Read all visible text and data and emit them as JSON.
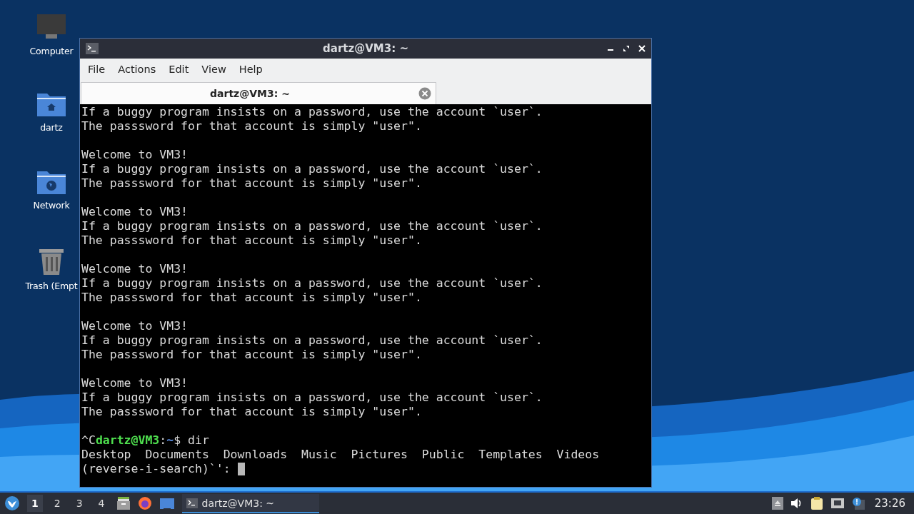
{
  "desktop_icons": [
    {
      "label": "Computer",
      "kind": "computer"
    },
    {
      "label": "dartz",
      "kind": "home"
    },
    {
      "label": "Network",
      "kind": "network"
    },
    {
      "label": "Trash (Empt",
      "kind": "trash"
    }
  ],
  "window": {
    "title": "dartz@VM3: ~",
    "active": true
  },
  "menu": [
    "File",
    "Actions",
    "Edit",
    "View",
    "Help"
  ],
  "tabs": [
    {
      "label": "dartz@VM3: ~",
      "selected": true
    }
  ],
  "terminal": {
    "blocks": [
      {
        "lines": [
          "If a buggy program insists on a password, use the account `user`.",
          "The passsword for that account is simply \"user\"."
        ]
      },
      {
        "lines": [
          "Welcome to VM3!",
          "If a buggy program insists on a password, use the account `user`.",
          "The passsword for that account is simply \"user\"."
        ]
      },
      {
        "lines": [
          "Welcome to VM3!",
          "If a buggy program insists on a password, use the account `user`.",
          "The passsword for that account is simply \"user\"."
        ]
      },
      {
        "lines": [
          "Welcome to VM3!",
          "If a buggy program insists on a password, use the account `user`.",
          "The passsword for that account is simply \"user\"."
        ]
      },
      {
        "lines": [
          "Welcome to VM3!",
          "If a buggy program insists on a password, use the account `user`.",
          "The passsword for that account is simply \"user\"."
        ]
      },
      {
        "lines": [
          "Welcome to VM3!",
          "If a buggy program insists on a password, use the account `user`.",
          "The passsword for that account is simply \"user\"."
        ]
      }
    ],
    "prompt": {
      "prefix": "^C",
      "user_host": "dartz@VM3",
      "separator": ":",
      "path": "~",
      "symbol": "$",
      "command": "dir"
    },
    "output": "Desktop  Documents  Downloads  Music  Pictures  Public  Templates  Videos",
    "search": "(reverse-i-search)`': "
  },
  "taskbar": {
    "workspaces": [
      {
        "label": "1",
        "selected": true
      },
      {
        "label": "2",
        "selected": false
      },
      {
        "label": "3",
        "selected": false
      },
      {
        "label": "4",
        "selected": false
      }
    ],
    "tasks": [
      {
        "label": "dartz@VM3: ~",
        "selected": true
      }
    ],
    "clock": "23:26"
  }
}
